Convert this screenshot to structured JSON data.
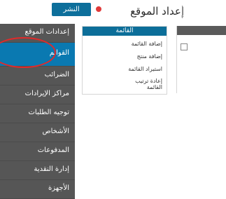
{
  "header": {
    "title": "إعداد الموقع",
    "publish_label": "النشر"
  },
  "sidebar": {
    "items": [
      {
        "label": "إعدادات الموقع"
      },
      {
        "label": "القوائم",
        "active": true
      },
      {
        "label": "الضرائب"
      },
      {
        "label": "مراكز الإيرادات"
      },
      {
        "label": "توجيه الطلبات"
      },
      {
        "label": "الأشخاص"
      },
      {
        "label": "المدفوعات"
      },
      {
        "label": "إدارة النقدية"
      },
      {
        "label": "الأجهزة"
      }
    ]
  },
  "menu_panel": {
    "header": "القائمة",
    "items": [
      {
        "label": "إضافة القائمة"
      },
      {
        "label": "إضافة منتج"
      },
      {
        "label": "استيراد القائمة"
      },
      {
        "label": "إعادة ترتيب القائمة"
      }
    ]
  },
  "colors": {
    "accent": "#0d6f9b",
    "sidebar_bg": "#565656",
    "active_item": "#0a79b1",
    "annotation": "#e12a2a"
  }
}
